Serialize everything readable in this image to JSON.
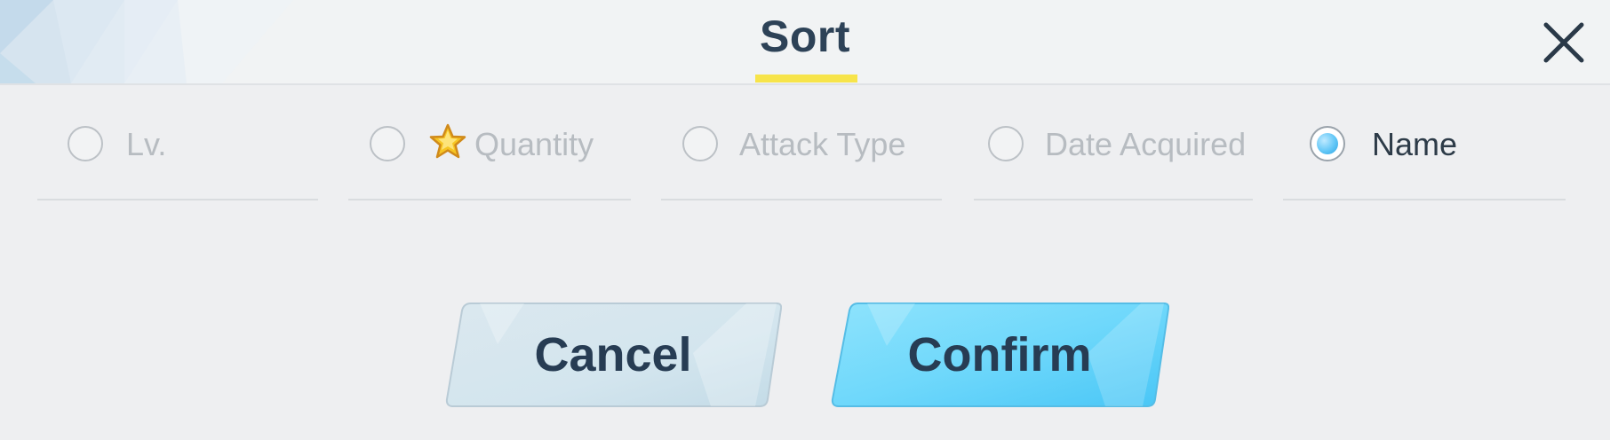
{
  "dialog": {
    "title": "Sort",
    "accent_color": "#f7e44a"
  },
  "sort_options": [
    {
      "label": "Lv.",
      "selected": false
    },
    {
      "label": "Quantity",
      "selected": false,
      "icon": "star-icon"
    },
    {
      "label": "Attack Type",
      "selected": false
    },
    {
      "label": "Date Acquired",
      "selected": false
    },
    {
      "label": "Name",
      "selected": true
    }
  ],
  "buttons": {
    "cancel_label": "Cancel",
    "confirm_label": "Confirm",
    "confirm_color": "#6dd8fb",
    "cancel_color": "#d6e7ee"
  },
  "icons": {
    "close": "close-icon",
    "radio_selected": "radio-selected-icon",
    "radio_unselected": "radio-unselected-icon"
  }
}
